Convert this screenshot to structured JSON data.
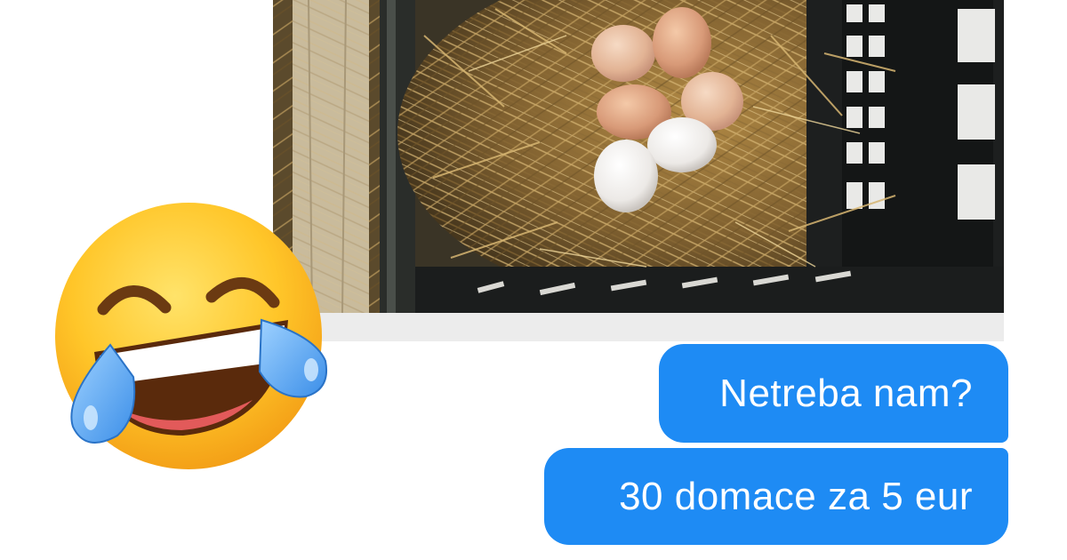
{
  "conversation": {
    "photo": {
      "description_icon": "photo-eggs-in-nest-icon"
    },
    "messages": [
      {
        "text": "Netreba nam?"
      },
      {
        "text": "30 domace za 5 eur"
      }
    ]
  },
  "reaction": {
    "icon": "face-with-tears-of-joy-icon"
  },
  "colors": {
    "bubble": "#1e8bf4",
    "bubble_text": "#ffffff",
    "background": "#ffffff"
  }
}
